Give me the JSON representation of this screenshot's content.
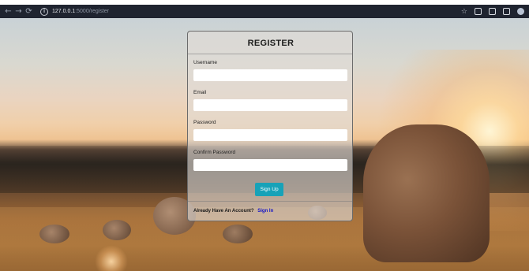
{
  "browser": {
    "nav_back": "←",
    "nav_forward": "→",
    "nav_reload": "⟳",
    "url_host": "127.0.0.1",
    "url_path": ":5000/register",
    "icons": [
      "info-icon",
      "star-icon",
      "extension-icon",
      "puzzle-icon",
      "sidebar-icon",
      "profile-icon"
    ]
  },
  "form": {
    "title": "REGISTER",
    "fields": [
      {
        "label": "Username",
        "value": ""
      },
      {
        "label": "Email",
        "value": ""
      },
      {
        "label": "Password",
        "value": ""
      },
      {
        "label": "Confirm Password",
        "value": ""
      }
    ],
    "submit_label": "Sign Up",
    "footer_text": "Already Have An Account?",
    "signin_label": "Sign In"
  },
  "colors": {
    "accent": "#17a2b8",
    "link": "#1212c8",
    "browser_bar": "#1f2430"
  }
}
